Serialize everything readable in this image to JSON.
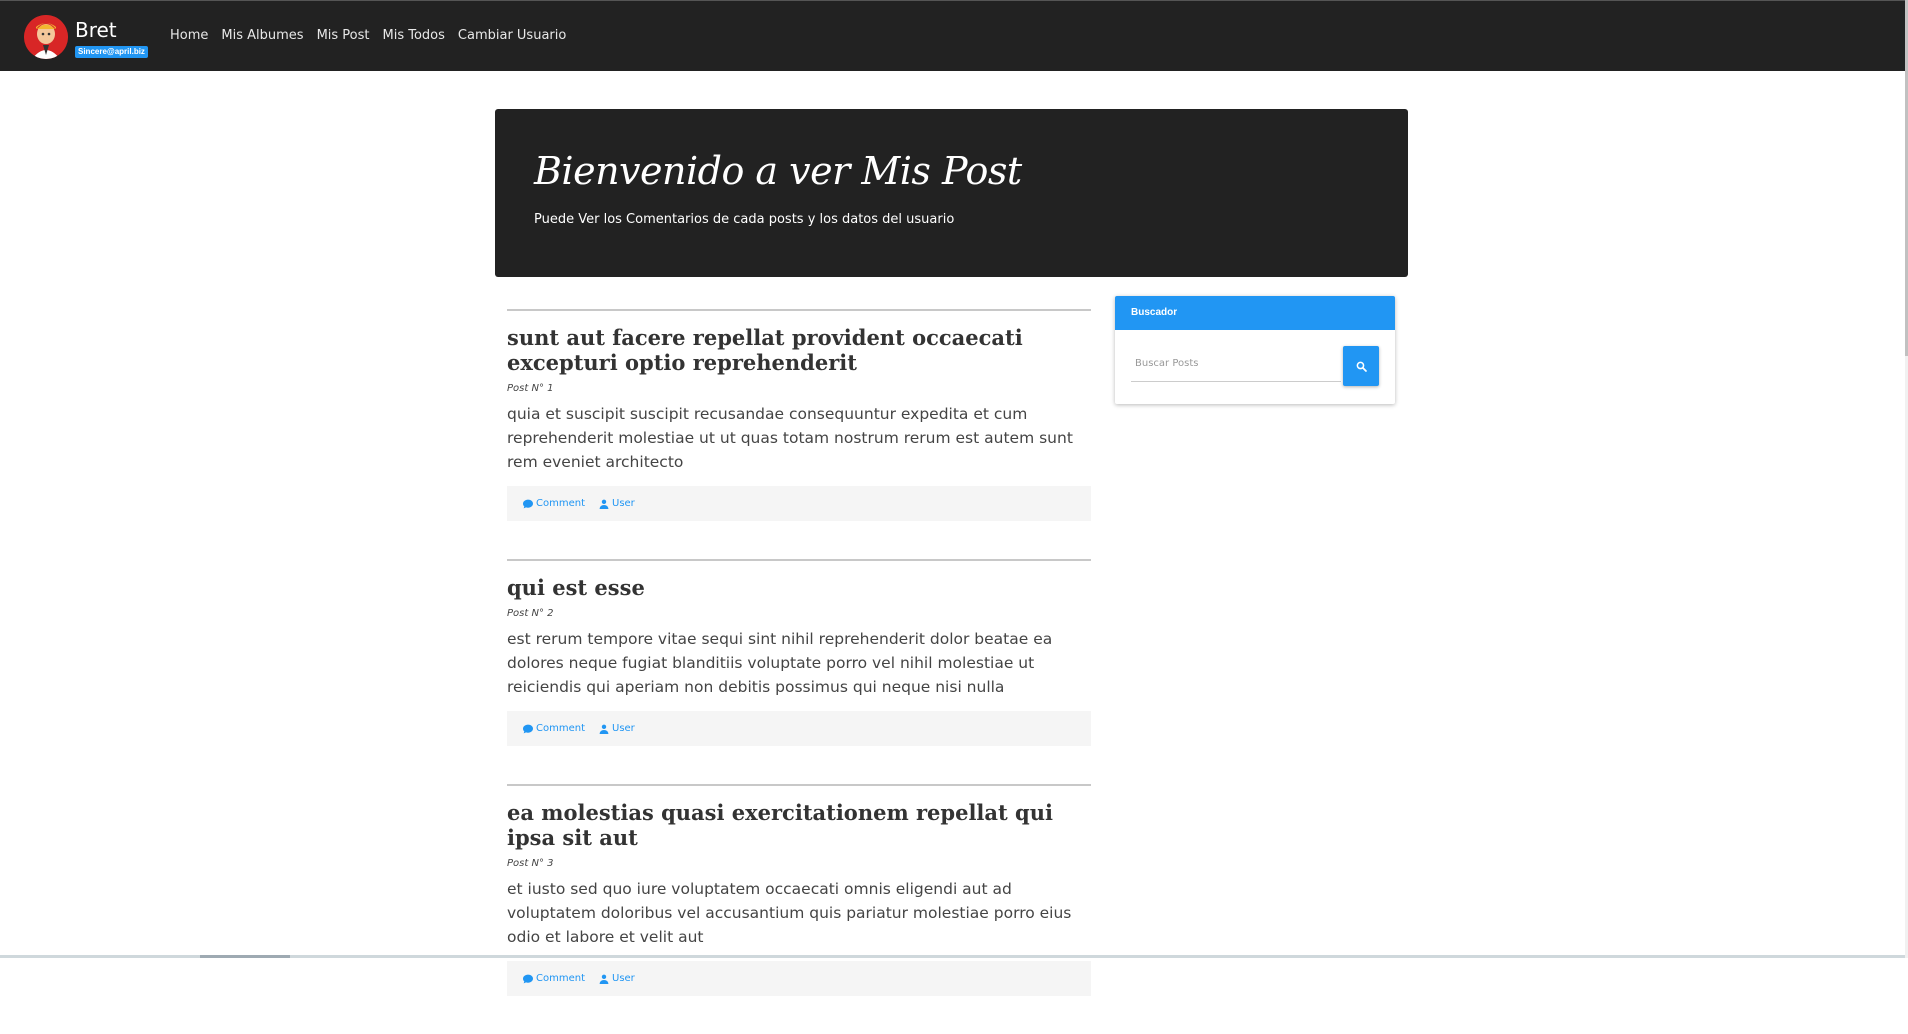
{
  "nav": {
    "brand_name": "Bret",
    "brand_email": "Sincere@april.biz",
    "links": [
      "Home",
      "Mis Albumes",
      "Mis Post",
      "Mis Todos",
      "Cambiar Usuario"
    ]
  },
  "hero": {
    "title": "Bienvenido a ver Mis Post",
    "subtitle": "Puede Ver los Comentarios de cada posts y los datos del usuario"
  },
  "posts": [
    {
      "title": "sunt aut facere repellat provident occaecati excepturi optio reprehenderit",
      "number": "Post N° 1",
      "body": "quia et suscipit suscipit recusandae consequuntur expedita et cum reprehenderit molestiae ut ut quas totam nostrum rerum est autem sunt rem eveniet architecto",
      "comment_label": "Comment",
      "user_label": "User"
    },
    {
      "title": "qui est esse",
      "number": "Post N° 2",
      "body": "est rerum tempore vitae sequi sint nihil reprehenderit dolor beatae ea dolores neque fugiat blanditiis voluptate porro vel nihil molestiae ut reiciendis qui aperiam non debitis possimus qui neque nisi nulla",
      "comment_label": "Comment",
      "user_label": "User"
    },
    {
      "title": "ea molestias quasi exercitationem repellat qui ipsa sit aut",
      "number": "Post N° 3",
      "body": "et iusto sed quo iure voluptatem occaecati omnis eligendi aut ad voluptatem doloribus vel accusantium quis pariatur molestiae porro eius odio et labore et velit aut",
      "comment_label": "Comment",
      "user_label": "User"
    }
  ],
  "sidebar": {
    "header": "Buscador",
    "search_placeholder": "Buscar Posts"
  },
  "colors": {
    "accent": "#2196f3",
    "navbar": "#222222"
  },
  "icons": {
    "comment": "comment-icon",
    "user": "user-icon",
    "search": "search-icon"
  }
}
